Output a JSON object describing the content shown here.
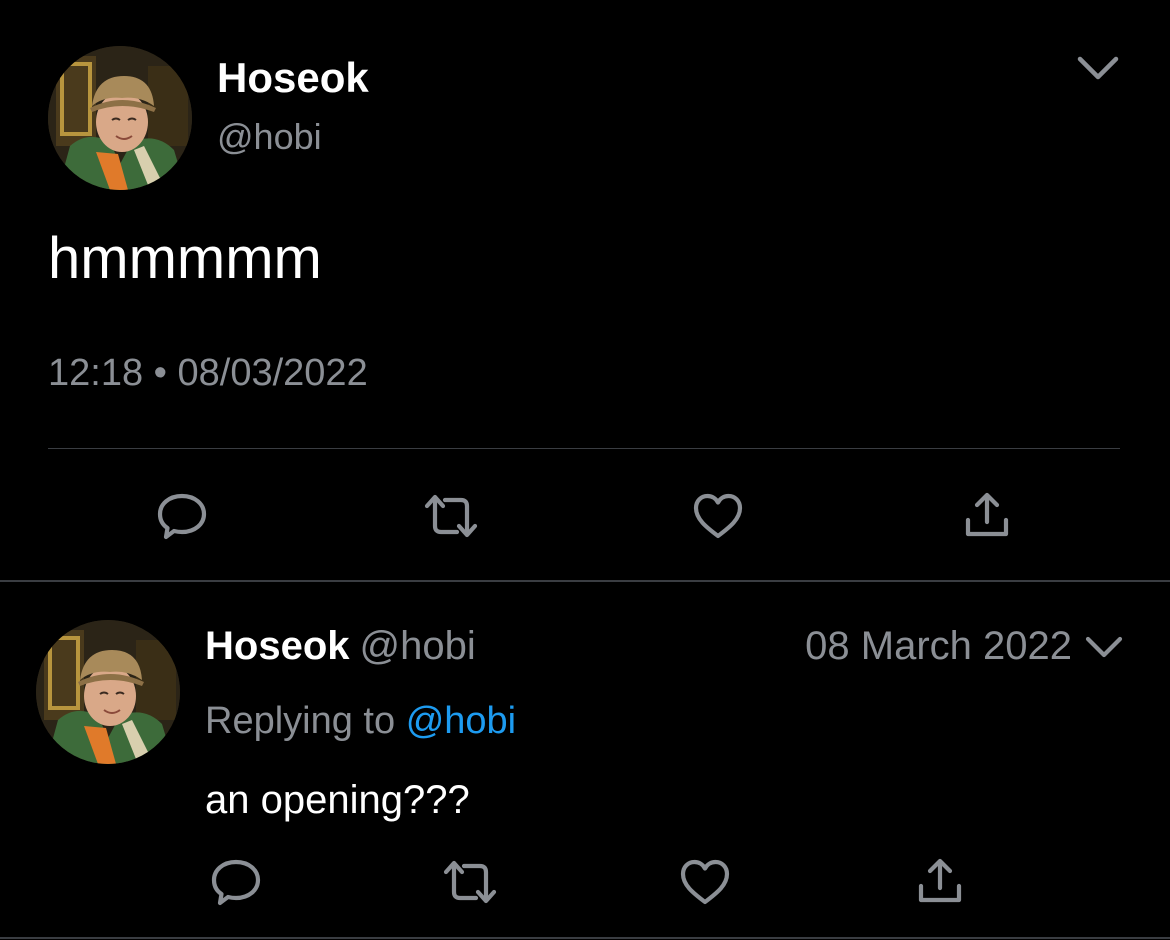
{
  "colors": {
    "background": "#000000",
    "text_primary": "#ffffff",
    "text_secondary": "#8b8f95",
    "link": "#1d9bf0",
    "divider": "#3a3d42",
    "icon": "#8b8f95"
  },
  "main_tweet": {
    "display_name": "Hoseok",
    "handle": "@hobi",
    "text": "hmmmmm",
    "timestamp": "12:18 • 08/03/2022",
    "menu_icon": "chevron-down-icon",
    "actions": [
      {
        "name": "reply",
        "icon": "reply-icon"
      },
      {
        "name": "retweet",
        "icon": "retweet-icon"
      },
      {
        "name": "like",
        "icon": "heart-icon"
      },
      {
        "name": "share",
        "icon": "share-icon"
      }
    ]
  },
  "reply_tweet": {
    "display_name": "Hoseok",
    "handle": "@hobi",
    "date": "08 March 2022",
    "replying_to_label": "Replying to",
    "replying_to_handle": "@hobi",
    "text": "an opening???",
    "menu_icon": "chevron-down-icon",
    "actions": [
      {
        "name": "reply",
        "icon": "reply-icon"
      },
      {
        "name": "retweet",
        "icon": "retweet-icon"
      },
      {
        "name": "like",
        "icon": "heart-icon"
      },
      {
        "name": "share",
        "icon": "share-icon"
      }
    ]
  }
}
